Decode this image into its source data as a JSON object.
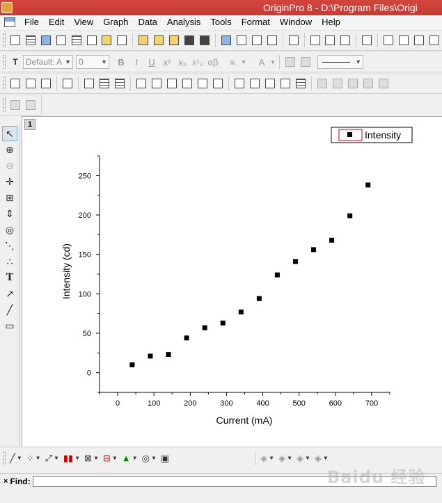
{
  "window": {
    "title": "OriginPro 8 - D:\\Program Files\\Origi"
  },
  "menu": [
    "File",
    "Edit",
    "View",
    "Graph",
    "Data",
    "Analysis",
    "Tools",
    "Format",
    "Window",
    "Help"
  ],
  "format_toolbar": {
    "font_value": "Default: A",
    "size_value": "0",
    "glyphs": [
      "B",
      "I",
      "U",
      "x²",
      "x₂",
      "x¹₂",
      "αβ",
      "≡",
      "A"
    ]
  },
  "graph": {
    "layer_number": "1",
    "legend_label": "Intensity",
    "colors": {
      "marker": "#000000",
      "legend_box_border": "#cc0000",
      "background": "#ffffff"
    }
  },
  "chart_data": {
    "type": "scatter",
    "xlabel": "Current (mA)",
    "ylabel": "Intensity (cd)",
    "xlim": [
      -50,
      750
    ],
    "ylim": [
      -25,
      275
    ],
    "xticks": [
      0,
      100,
      200,
      300,
      400,
      500,
      600,
      700
    ],
    "yticks": [
      0,
      50,
      100,
      150,
      200,
      250
    ],
    "series": [
      {
        "name": "Intensity",
        "marker": "square",
        "x": [
          40,
          90,
          140,
          190,
          240,
          290,
          340,
          390,
          440,
          490,
          540,
          590,
          640,
          690
        ],
        "y": [
          10,
          21,
          23,
          44,
          57,
          63,
          77,
          94,
          124,
          141,
          156,
          168,
          199,
          238
        ]
      }
    ]
  },
  "find_bar": {
    "label": "Find:",
    "close": "×",
    "value": ""
  },
  "watermark": "Baidu 经验"
}
